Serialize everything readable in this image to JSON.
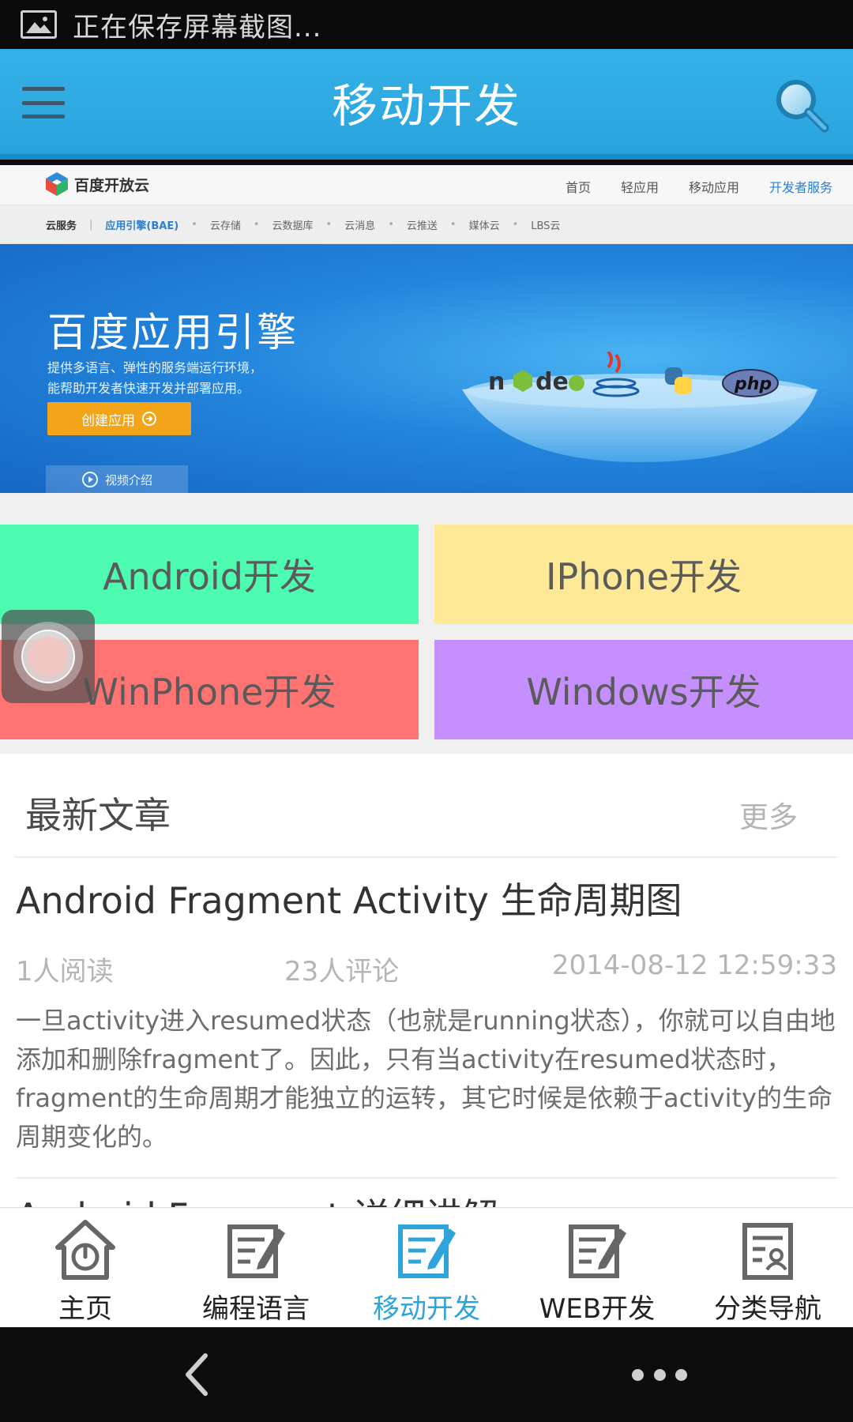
{
  "status_bar": {
    "text": "正在保存屏幕截图..."
  },
  "header": {
    "title": "移动开发",
    "menu_icon": "menu-icon",
    "search_icon": "search-icon"
  },
  "banner": {
    "logo_text": "百度开放云",
    "nav_links": [
      "首页",
      "轻应用",
      "移动应用",
      "开发者服务"
    ],
    "sub_nav": [
      "云服务",
      "应用引擎(BAE)",
      "云存储",
      "云数据库",
      "云消息",
      "云推送",
      "媒体云",
      "LBS云"
    ],
    "hero_title": "百度应用引擎",
    "hero_desc_1": "提供多语言、弹性的服务端运行环境，",
    "hero_desc_2": "能帮助开发者快速开发并部署应用。",
    "create_button": "创建应用",
    "video_button": "视频介绍",
    "tech_logos": [
      "node",
      "java",
      "python",
      "php"
    ]
  },
  "tiles": [
    {
      "label": "Android开发",
      "color": "#4dfcb0"
    },
    {
      "label": "IPhone开发",
      "color": "#fde996"
    },
    {
      "label": "WinPhone开发",
      "color": "#ff7472"
    },
    {
      "label": "Windows开发",
      "color": "#c590fd"
    }
  ],
  "latest": {
    "section_title": "最新文章",
    "more_label": "更多",
    "articles": [
      {
        "title": "Android Fragment Activity 生命周期图",
        "reads": "1人阅读",
        "comments": "23人评论",
        "time": "2014-08-12 12:59:33",
        "summary": "一旦activity进入resumed状态（也就是running状态），你就可以自由地添加和删除fragment了。因此，只有当activity在resumed状态时，fragment的生命周期才能独立的运转，其它时候是依赖于activity的生命周期变化的。"
      }
    ],
    "next_title_peek": "Android Fragment 详细讲解"
  },
  "tabbar": {
    "active_index": 2,
    "accent_color": "#2ea4da",
    "tabs": [
      {
        "label": "主页",
        "icon": "home-icon"
      },
      {
        "label": "编程语言",
        "icon": "edit-icon"
      },
      {
        "label": "移动开发",
        "icon": "edit-icon"
      },
      {
        "label": "WEB开发",
        "icon": "edit-icon"
      },
      {
        "label": "分类导航",
        "icon": "profile-card-icon"
      }
    ]
  },
  "navbar": {
    "back_icon": "back-icon",
    "more_icon": "more-icon"
  }
}
